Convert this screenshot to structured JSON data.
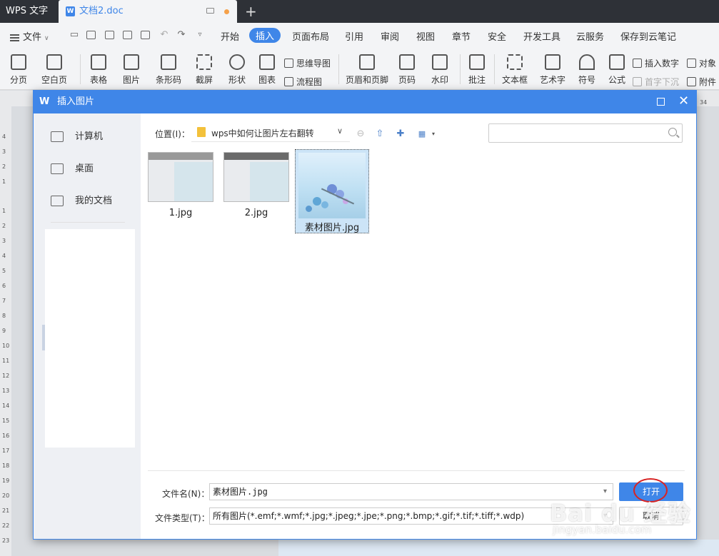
{
  "app": {
    "name": "WPS 文字",
    "doc_tab": "文档2.doc",
    "doc_icon": "W"
  },
  "menu": {
    "file": "文件",
    "items": [
      "开始",
      "插入",
      "页面布局",
      "引用",
      "审阅",
      "视图",
      "章节",
      "安全",
      "开发工具",
      "云服务",
      "保存到云笔记"
    ],
    "active": "插入"
  },
  "ribbon": {
    "buttons": [
      "分页",
      "空白页",
      "表格",
      "图片",
      "条形码",
      "截屏",
      "形状",
      "图表",
      "页眉和页脚",
      "页码",
      "水印",
      "批注",
      "文本框",
      "艺术字",
      "符号",
      "公式"
    ],
    "small": {
      "mindmap": "思维导图",
      "flowchart": "流程图",
      "insert_number": "插入数字",
      "first_sink": "首字下沉",
      "object": "对象",
      "attachment": "附件"
    }
  },
  "ruler": {
    "top_number": "34",
    "ticks": [
      "4",
      "3",
      "2",
      "1",
      "1",
      "2",
      "3",
      "4",
      "5",
      "6",
      "7",
      "8",
      "9",
      "10",
      "11",
      "12",
      "13",
      "14",
      "15",
      "16",
      "17",
      "18",
      "19",
      "20",
      "21",
      "22",
      "23"
    ]
  },
  "dialog": {
    "title": "插入图片",
    "logo": "W",
    "sidebar": [
      "计算机",
      "桌面",
      "我的文档"
    ],
    "location_label": "位置(I)：",
    "location_value": "wps中如何让图片左右翻转",
    "files": [
      {
        "name": "1.jpg"
      },
      {
        "name": "2.jpg"
      },
      {
        "name": "素材图片.jpg",
        "selected": true
      }
    ],
    "search_placeholder": "",
    "filename_label": "文件名(N)：",
    "filename_value": "素材图片.jpg",
    "filetype_label": "文件类型(T)：",
    "filetype_value": "所有图片(*.emf;*.wmf;*.jpg;*.jpeg;*.jpe;*.png;*.bmp;*.gif;*.tif;*.tiff;*.wdp)",
    "open_label": "打开",
    "cancel_label": "取消"
  },
  "watermark": {
    "brand": "Bai du 经验",
    "url": "jingyan.baidu.com"
  },
  "colors": {
    "accent": "#3f86e8",
    "titlebar": "#2e3137",
    "highlight_ring": "#d82323"
  }
}
